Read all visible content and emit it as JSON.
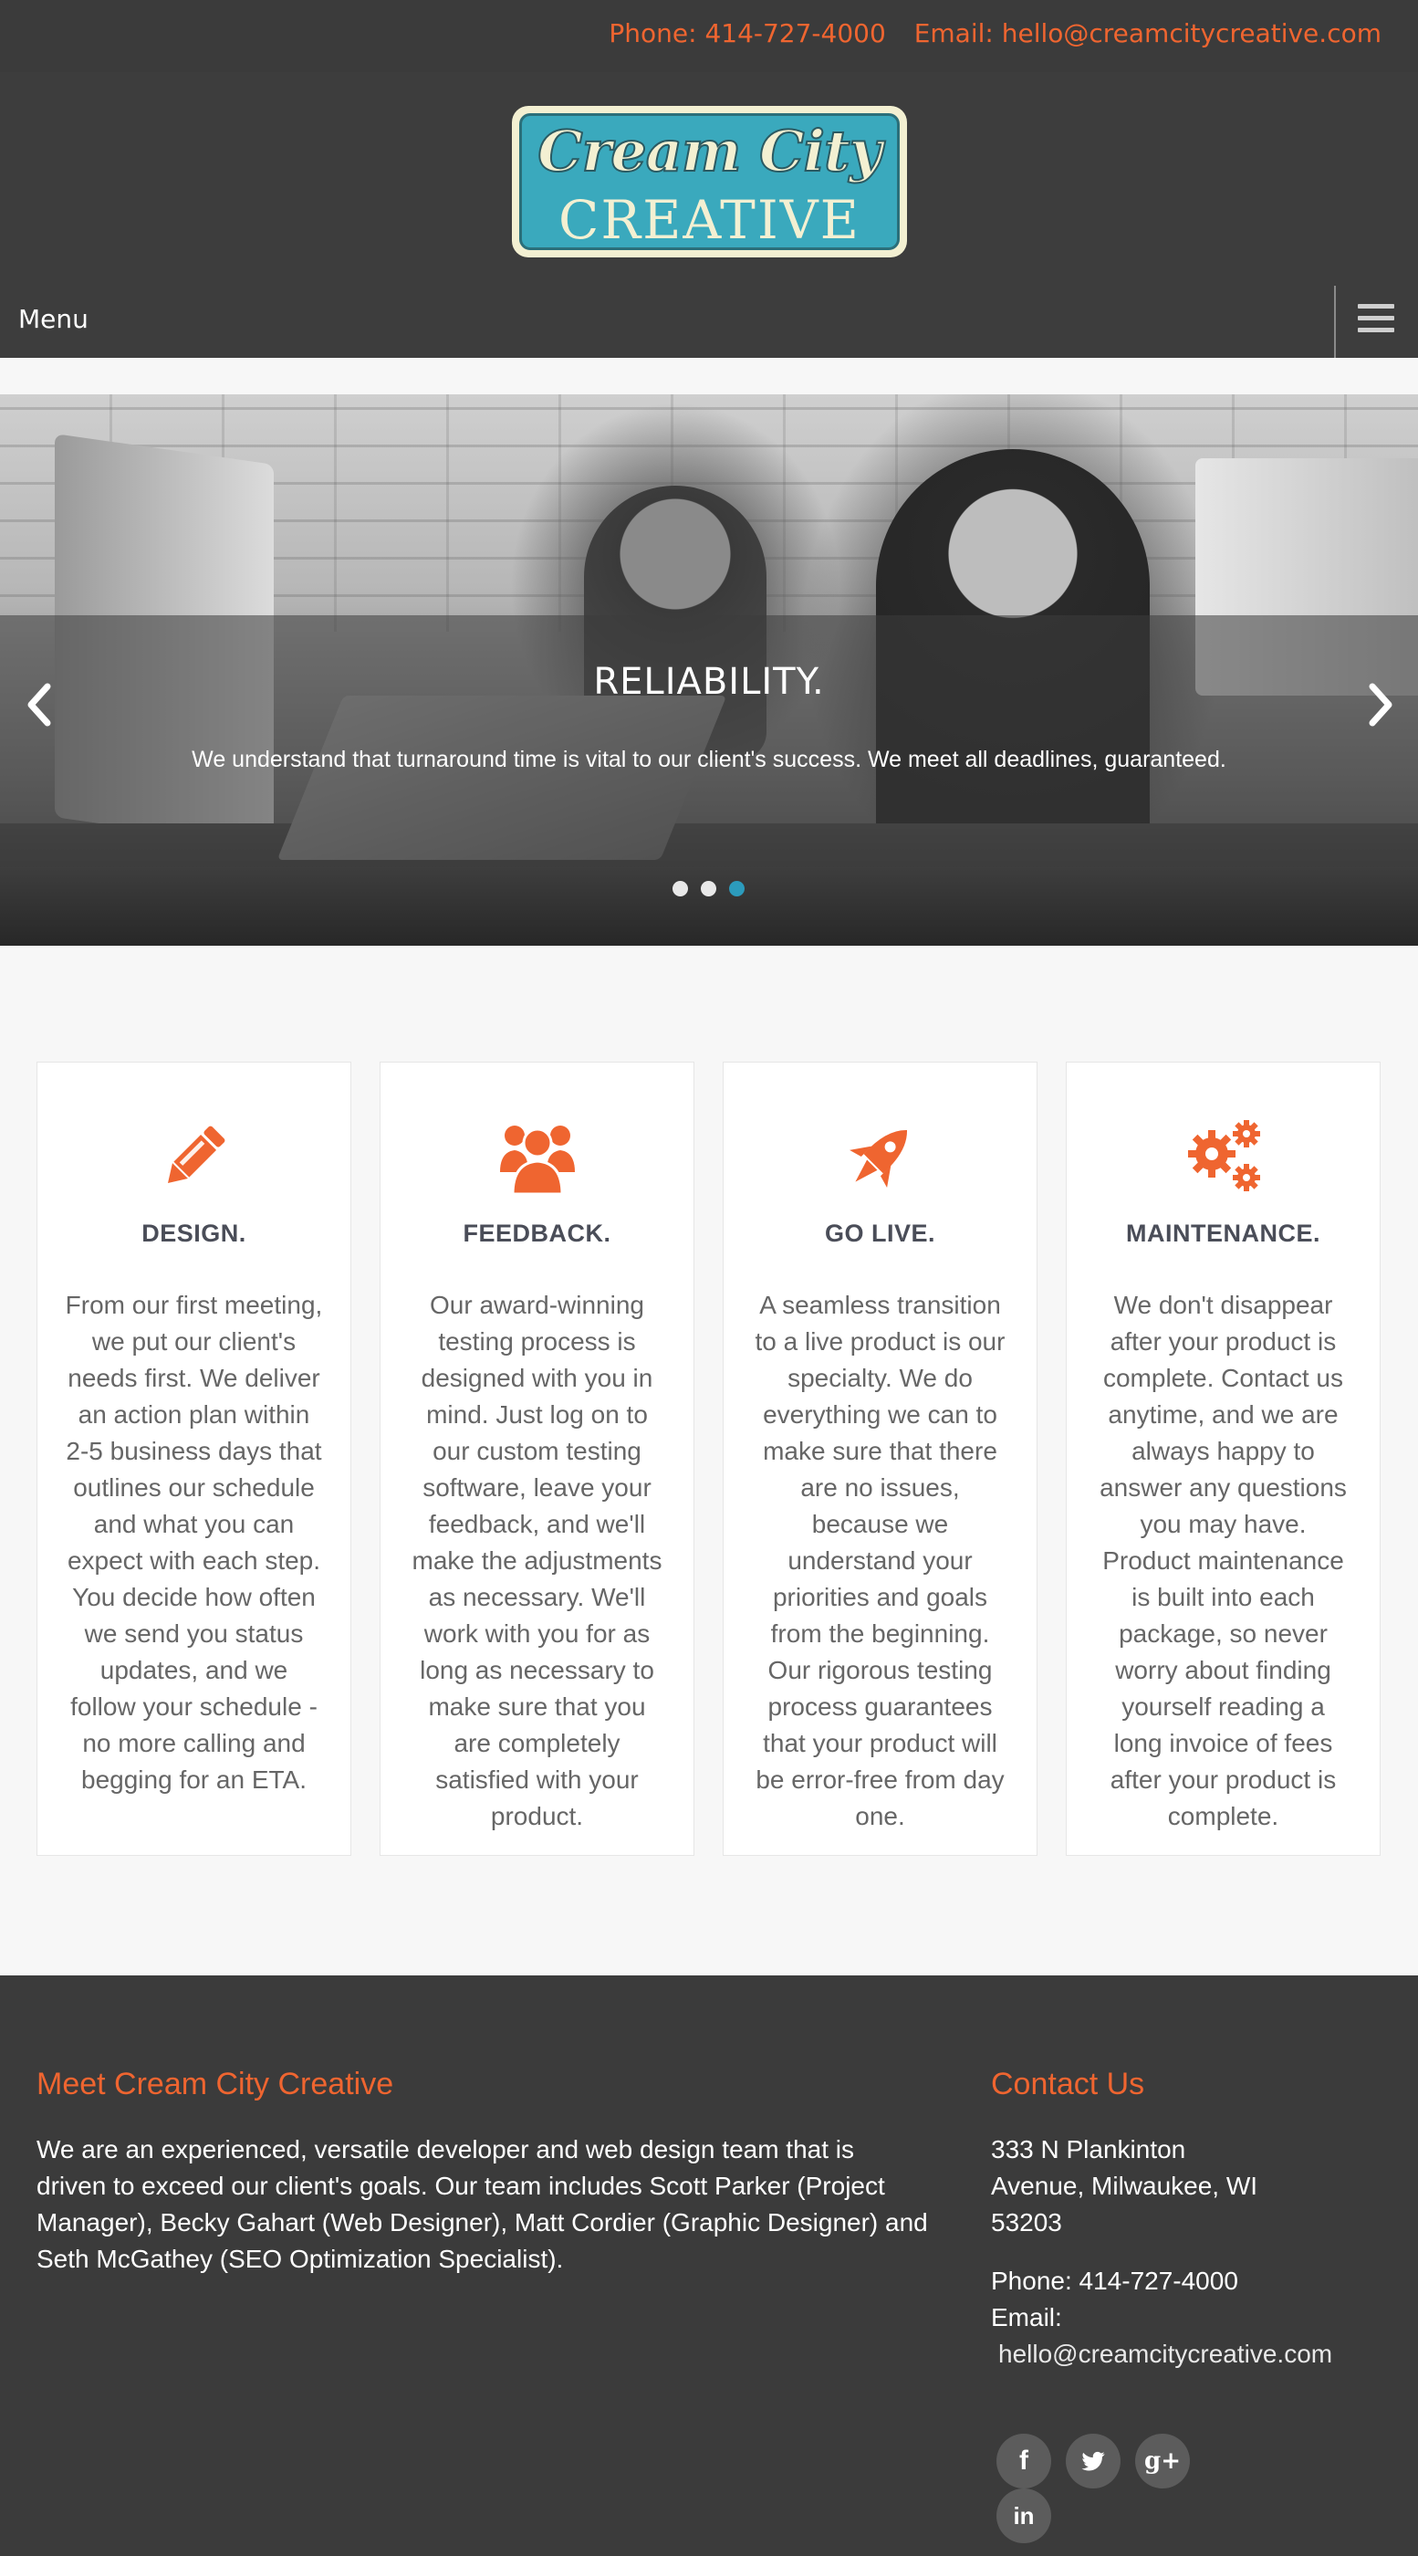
{
  "topbar": {
    "phone": "Phone: 414-727-4000",
    "email": "Email: hello@creamcitycreative.com"
  },
  "logo": {
    "line1": "Cream City",
    "line2": "CREATIVE"
  },
  "nav": {
    "menu_label": "Menu",
    "menu_icon": "hamburger-icon"
  },
  "hero": {
    "title": "RELIABILITY.",
    "text": "We understand that turnaround time is vital to our client's success. We meet all deadlines, guaranteed.",
    "slide_count": 3,
    "active_slide": 3
  },
  "features": [
    {
      "icon": "pencil-icon",
      "title": "DESIGN.",
      "text": "From our first meeting, we put our client's needs first. We deliver an action plan within 2-5 business days that outlines our schedule and what you can expect with each step. You decide how often we send you status updates, and we follow your schedule - no more calling and begging for an ETA."
    },
    {
      "icon": "users-icon",
      "title": "FEEDBACK.",
      "text": "Our award-winning testing process is designed with you in mind. Just log on to our custom testing software, leave your feedback, and we'll make the adjustments as necessary. We'll work with you for as long as necessary to make sure that you are completely satisfied with your product."
    },
    {
      "icon": "rocket-icon",
      "title": "GO LIVE.",
      "text": "A seamless transition to a live product is our specialty. We do everything we can to make sure that there are no issues, because we understand your priorities and goals from the beginning. Our rigorous testing process guarantees that your product will be error-free from day one."
    },
    {
      "icon": "gears-icon",
      "title": "MAINTENANCE.",
      "text": "We don't disappear after your product is complete. Contact us anytime, and we are always happy to answer any questions you may have. Product maintenance is built into each package, so never worry about finding yourself reading a long invoice of fees after your product is complete."
    }
  ],
  "footer": {
    "about_title": "Meet Cream City Creative",
    "about_text": "We are an experienced, versatile developer and web design team that is driven to exceed our client's goals. Our team includes Scott Parker (Project Manager), Becky Gahart (Web Designer), Matt Cordier (Graphic Designer) and Seth McGathey (SEO Optimization Specialist).",
    "contact_title": "Contact Us",
    "address_line1": "333 N Plankinton",
    "address_line2": "Avenue, Milwaukee, WI",
    "address_line3": "53203",
    "phone": "Phone: 414-727-4000",
    "email_label": "Email:",
    "email_value": "hello@creamcitycreative.com",
    "social": [
      {
        "icon": "facebook-icon",
        "glyph": "f"
      },
      {
        "icon": "twitter-icon",
        "glyph": "t"
      },
      {
        "icon": "google-plus-icon",
        "glyph": "g+"
      },
      {
        "icon": "linkedin-icon",
        "glyph": "in"
      }
    ]
  },
  "colors": {
    "accent": "#ef6530",
    "dark_bg": "#3b3b3b",
    "active_dot": "#2c9bbc",
    "heading_text": "#4a4d58"
  }
}
